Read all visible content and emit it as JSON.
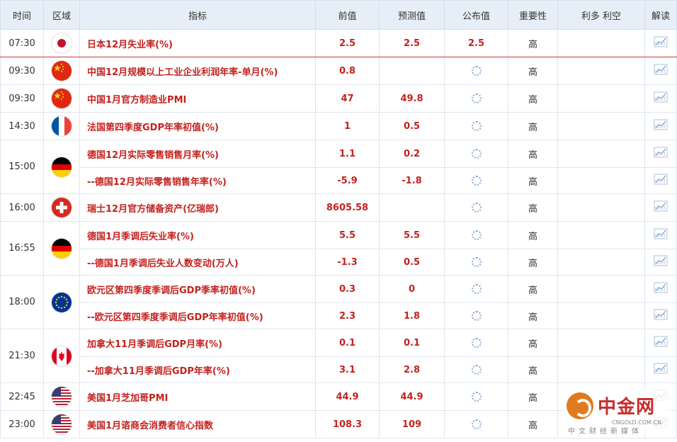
{
  "columns": {
    "time": "时间",
    "region": "区域",
    "indicator": "指标",
    "previous": "前值",
    "forecast": "预测值",
    "actual": "公布值",
    "importance": "重要性",
    "bull_bear": "利多 利空",
    "analysis": "解读"
  },
  "rows": [
    {
      "time": "07:30",
      "flag": "jp",
      "indicator": "日本12月失业率(%)",
      "previous": "2.5",
      "forecast": "2.5",
      "actual": "2.5",
      "importance": "高"
    },
    {
      "time": "09:30",
      "flag": "cn",
      "indicator": "中国12月规模以上工业企业利润年率-单月(%)",
      "previous": "0.8",
      "forecast": "",
      "actual": "",
      "importance": "高"
    },
    {
      "time": "09:30",
      "flag": "cn",
      "indicator": "中国1月官方制造业PMI",
      "previous": "47",
      "forecast": "49.8",
      "actual": "",
      "importance": "高"
    },
    {
      "time": "14:30",
      "flag": "fr",
      "indicator": "法国第四季度GDP年率初值(%)",
      "previous": "1",
      "forecast": "0.5",
      "actual": "",
      "importance": "高"
    },
    {
      "time": "15:00",
      "flag": "de",
      "indicator": "德国12月实际零售销售月率(%)",
      "previous": "1.1",
      "forecast": "0.2",
      "actual": "",
      "importance": "高"
    },
    {
      "time": "",
      "flag": "",
      "indicator": "--德国12月实际零售销售年率(%)",
      "previous": "-5.9",
      "forecast": "-1.8",
      "actual": "",
      "importance": "高"
    },
    {
      "time": "16:00",
      "flag": "ch",
      "indicator": "瑞士12月官方储备资产(亿瑞郎)",
      "previous": "8605.58",
      "forecast": "",
      "actual": "",
      "importance": "高"
    },
    {
      "time": "16:55",
      "flag": "de",
      "indicator": "德国1月季调后失业率(%)",
      "previous": "5.5",
      "forecast": "5.5",
      "actual": "",
      "importance": "高"
    },
    {
      "time": "",
      "flag": "",
      "indicator": "--德国1月季调后失业人数变动(万人)",
      "previous": "-1.3",
      "forecast": "0.5",
      "actual": "",
      "importance": "高"
    },
    {
      "time": "18:00",
      "flag": "eu",
      "indicator": "欧元区第四季度季调后GDP季率初值(%)",
      "previous": "0.3",
      "forecast": "0",
      "actual": "",
      "importance": "高"
    },
    {
      "time": "",
      "flag": "",
      "indicator": "--欧元区第四季度季调后GDP年率初值(%)",
      "previous": "2.3",
      "forecast": "1.8",
      "actual": "",
      "importance": "高"
    },
    {
      "time": "21:30",
      "flag": "ca",
      "indicator": "加拿大11月季调后GDP月率(%)",
      "previous": "0.1",
      "forecast": "0.1",
      "actual": "",
      "importance": "高"
    },
    {
      "time": "",
      "flag": "",
      "indicator": "--加拿大11月季调后GDP年率(%)",
      "previous": "3.1",
      "forecast": "2.8",
      "actual": "",
      "importance": "高"
    },
    {
      "time": "22:45",
      "flag": "us",
      "indicator": "美国1月芝加哥PMI",
      "previous": "44.9",
      "forecast": "44.9",
      "actual": "",
      "importance": "高"
    },
    {
      "time": "23:00",
      "flag": "us",
      "indicator": "美国1月谘商会消费者信心指数",
      "previous": "108.3",
      "forecast": "109",
      "actual": "",
      "importance": "高"
    }
  ],
  "watermark": {
    "brand": "中金网",
    "url": "CNGOLD.COM.CN",
    "subtitle": "中文财经新媒体"
  },
  "colors": {
    "header_bg": "#e6eef8",
    "indicator_text": "#c4221f",
    "grid": "#dfe6ee",
    "brand_red": "#c92a2a",
    "logo_orange": "#e07a1e"
  }
}
